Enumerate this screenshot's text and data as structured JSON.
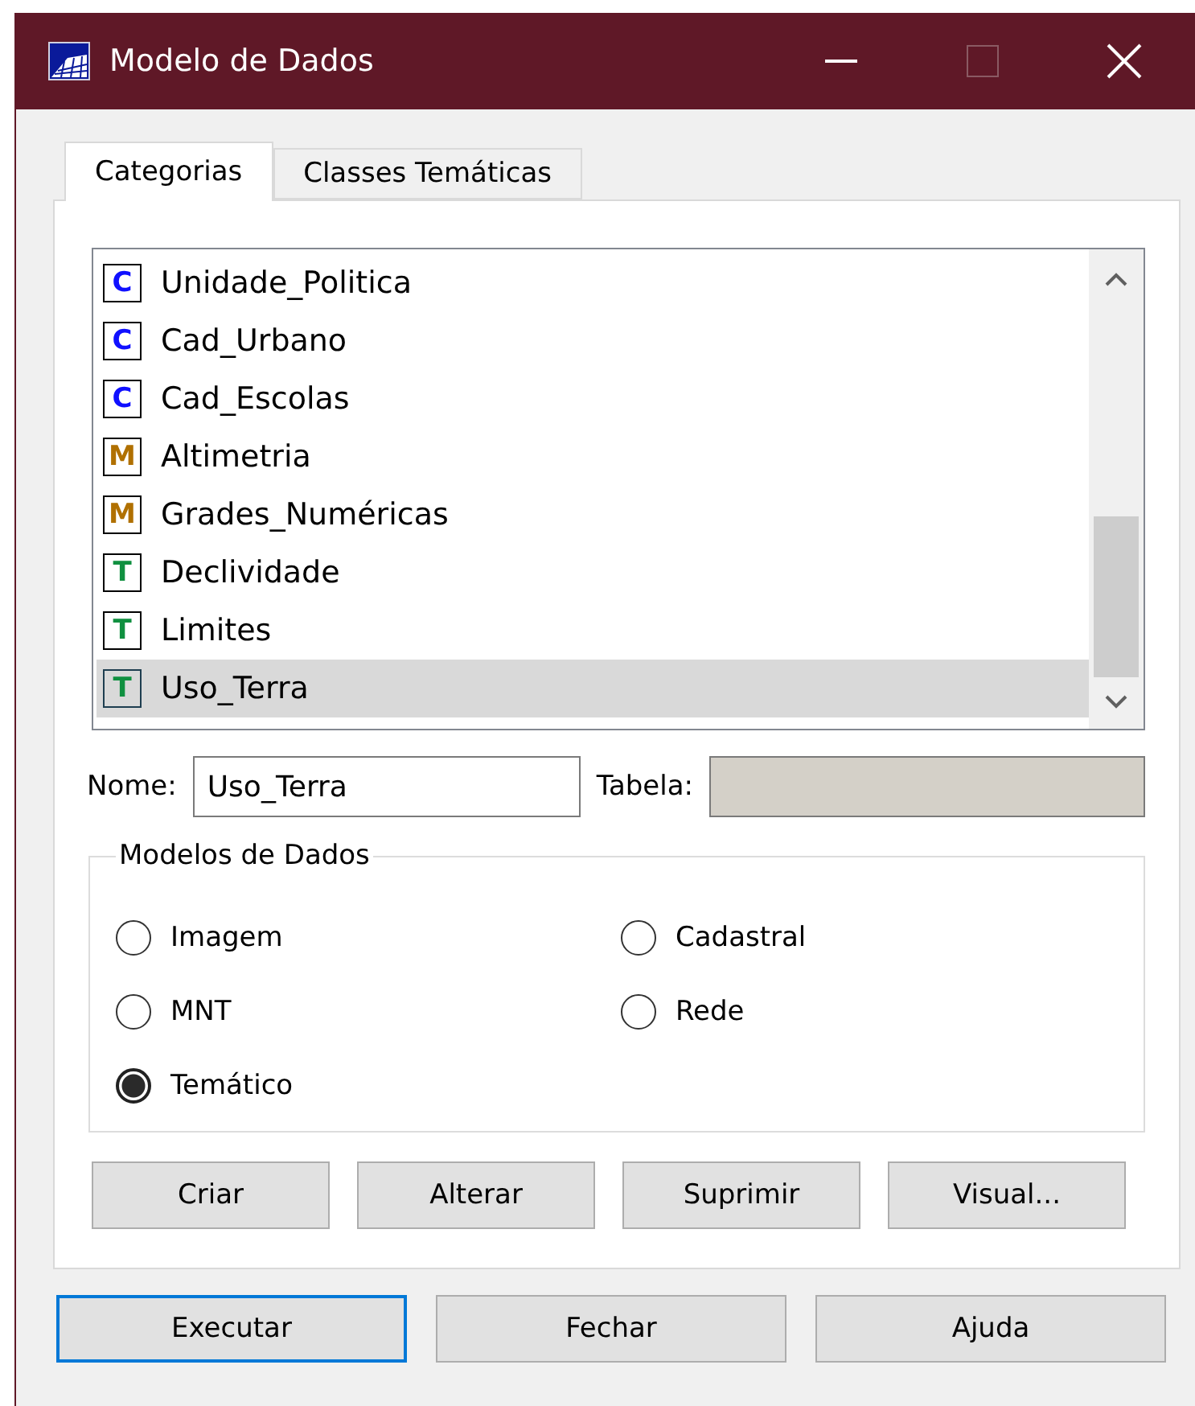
{
  "window": {
    "title": "Modelo de Dados"
  },
  "tabs": [
    {
      "label": "Categorias",
      "selected": true
    },
    {
      "label": "Classes Temáticas",
      "selected": false
    }
  ],
  "categories": [
    {
      "badge": "C",
      "kind": "cadastral",
      "name": "Unidade_Politica",
      "selected": false
    },
    {
      "badge": "C",
      "kind": "cadastral",
      "name": "Cad_Urbano",
      "selected": false
    },
    {
      "badge": "C",
      "kind": "cadastral",
      "name": "Cad_Escolas",
      "selected": false
    },
    {
      "badge": "M",
      "kind": "mnt",
      "name": "Altimetria",
      "selected": false
    },
    {
      "badge": "M",
      "kind": "mnt",
      "name": "Grades_Numéricas",
      "selected": false
    },
    {
      "badge": "T",
      "kind": "tematico",
      "name": "Declividade",
      "selected": false
    },
    {
      "badge": "T",
      "kind": "tematico",
      "name": "Limites",
      "selected": false
    },
    {
      "badge": "T",
      "kind": "tematico",
      "name": "Uso_Terra",
      "selected": true
    }
  ],
  "name_field": {
    "label": "Nome:",
    "value": "Uso_Terra"
  },
  "table_field": {
    "label": "Tabela:",
    "disabled": true
  },
  "data_models": {
    "title": "Modelos de Dados",
    "options": [
      {
        "label": "Imagem",
        "selected": false
      },
      {
        "label": "Cadastral",
        "selected": false
      },
      {
        "label": "MNT",
        "selected": false
      },
      {
        "label": "Rede",
        "selected": false
      },
      {
        "label": "Temático",
        "selected": true
      }
    ]
  },
  "actions": [
    "Criar",
    "Alterar",
    "Suprimir",
    "Visual..."
  ],
  "footer_buttons": [
    {
      "label": "Executar",
      "focused": true
    },
    {
      "label": "Fechar",
      "focused": false
    },
    {
      "label": "Ajuda",
      "focused": false
    }
  ]
}
